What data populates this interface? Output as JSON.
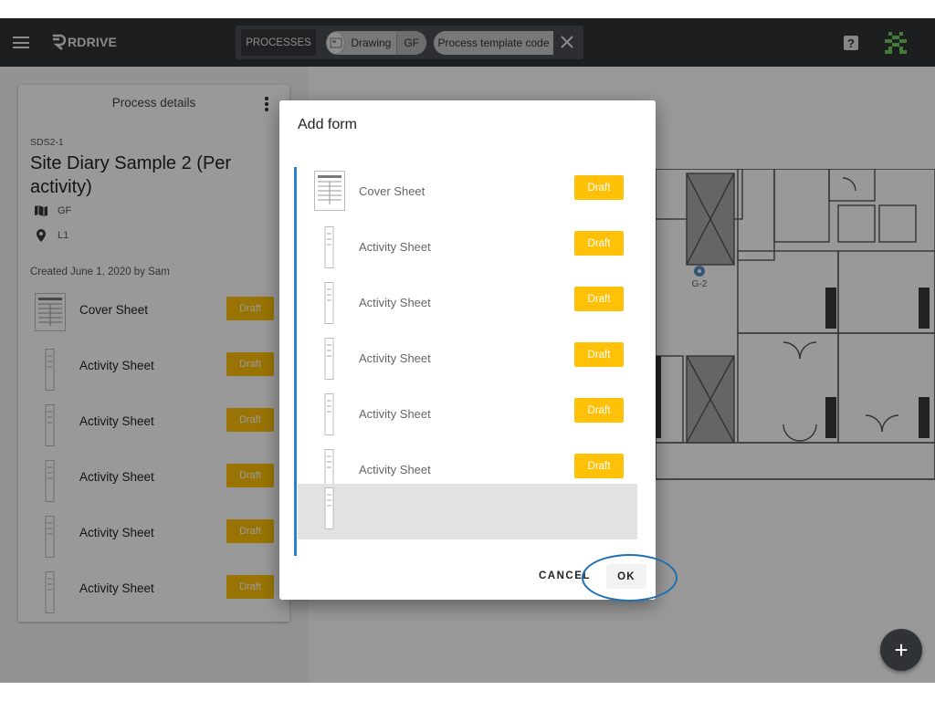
{
  "app": {
    "logo_text": "RDRIVE"
  },
  "topbar": {
    "processes_label": "PROCESSES",
    "drawing_chip": {
      "label": "Drawing",
      "floor": "GF"
    },
    "template_chip": {
      "label": "Process template code"
    }
  },
  "process_details": {
    "title": "Process details",
    "code": "SDS2-1",
    "name": "Site Diary Sample 2 (Per activity)",
    "drawing": "GF",
    "location": "L1",
    "created": "Created June 1, 2020 by Sam",
    "forms": [
      {
        "name": "Cover Sheet",
        "status": "Draft"
      },
      {
        "name": "Activity Sheet",
        "status": "Draft"
      },
      {
        "name": "Activity Sheet",
        "status": "Draft"
      },
      {
        "name": "Activity Sheet",
        "status": "Draft"
      },
      {
        "name": "Activity Sheet",
        "status": "Draft"
      },
      {
        "name": "Activity Sheet",
        "status": "Draft"
      }
    ]
  },
  "map": {
    "pin_label": "G-2"
  },
  "dialog": {
    "title": "Add form",
    "items": [
      {
        "name": "Cover Sheet",
        "status": "Draft"
      },
      {
        "name": "Activity Sheet",
        "status": "Draft"
      },
      {
        "name": "Activity Sheet",
        "status": "Draft"
      },
      {
        "name": "Activity Sheet",
        "status": "Draft"
      },
      {
        "name": "Activity Sheet",
        "status": "Draft"
      },
      {
        "name": "Activity Sheet",
        "status": "Draft"
      }
    ],
    "cancel_label": "CANCEL",
    "ok_label": "OK"
  },
  "fab": {
    "label": "+"
  }
}
